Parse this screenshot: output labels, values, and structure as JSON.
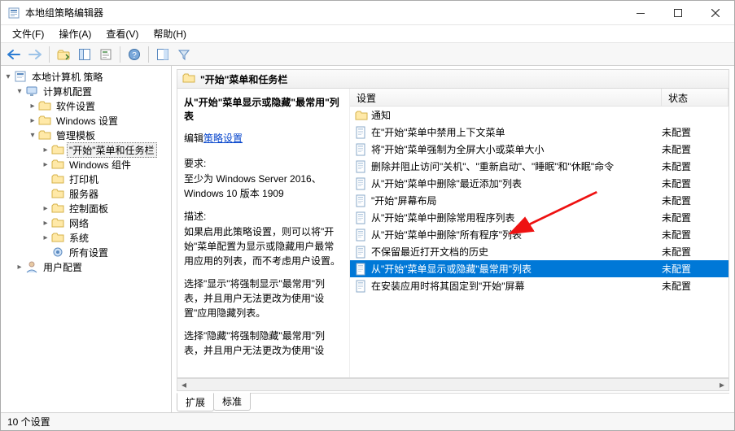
{
  "window": {
    "title": "本地组策略编辑器"
  },
  "menus": {
    "file": "文件(F)",
    "operate": "操作(A)",
    "view": "查看(V)",
    "help": "帮助(H)"
  },
  "tree": {
    "root": "本地计算机 策略",
    "computer_config": "计算机配置",
    "software_settings": "软件设置",
    "windows_settings": "Windows 设置",
    "admin_templates": "管理模板",
    "start_taskbar": "\"开始\"菜单和任务栏",
    "windows_components": "Windows 组件",
    "printers": "打印机",
    "servers": "服务器",
    "control_panel": "控制面板",
    "network": "网络",
    "system": "系统",
    "all_settings": "所有设置",
    "user_config": "用户配置"
  },
  "header": {
    "title": "\"开始\"菜单和任务栏"
  },
  "desc": {
    "title": "从\"开始\"菜单显示或隐藏\"最常用\"列表",
    "edit_link_prefix": "编辑",
    "edit_link": "策略设置",
    "req_label": "要求:",
    "req_value": "至少为 Windows Server 2016、Windows 10 版本 1909",
    "desc_label": "描述:",
    "p1": "如果启用此策略设置，则可以将\"开始\"菜单配置为显示或隐藏用户最常用应用的列表，而不考虑用户设置。",
    "p2": "选择\"显示\"将强制显示\"最常用\"列表，并且用户无法更改为使用\"设置\"应用隐藏列表。",
    "p3": "选择\"隐藏\"将强制隐藏\"最常用\"列表，并且用户无法更改为使用\"设"
  },
  "list": {
    "col_setting": "设置",
    "col_state": "状态",
    "group_notifications": "通知",
    "state_unconfigured": "未配置",
    "rows": [
      {
        "name": "在\"开始\"菜单中禁用上下文菜单"
      },
      {
        "name": "将\"开始\"菜单强制为全屏大小或菜单大小"
      },
      {
        "name": "删除并阻止访问\"关机\"、\"重新启动\"、\"睡眠\"和\"休眠\"命令"
      },
      {
        "name": "从\"开始\"菜单中删除\"最近添加\"列表"
      },
      {
        "name": "\"开始\"屏幕布局"
      },
      {
        "name": "从\"开始\"菜单中删除常用程序列表"
      },
      {
        "name": "从\"开始\"菜单中删除\"所有程序\"列表"
      },
      {
        "name": "不保留最近打开文档的历史"
      },
      {
        "name": "从\"开始\"菜单显示或隐藏\"最常用\"列表",
        "selected": true
      },
      {
        "name": "在安装应用时将其固定到\"开始\"屏幕"
      }
    ]
  },
  "tabs": {
    "extended": "扩展",
    "standard": "标准"
  },
  "status": {
    "text": "10 个设置"
  }
}
